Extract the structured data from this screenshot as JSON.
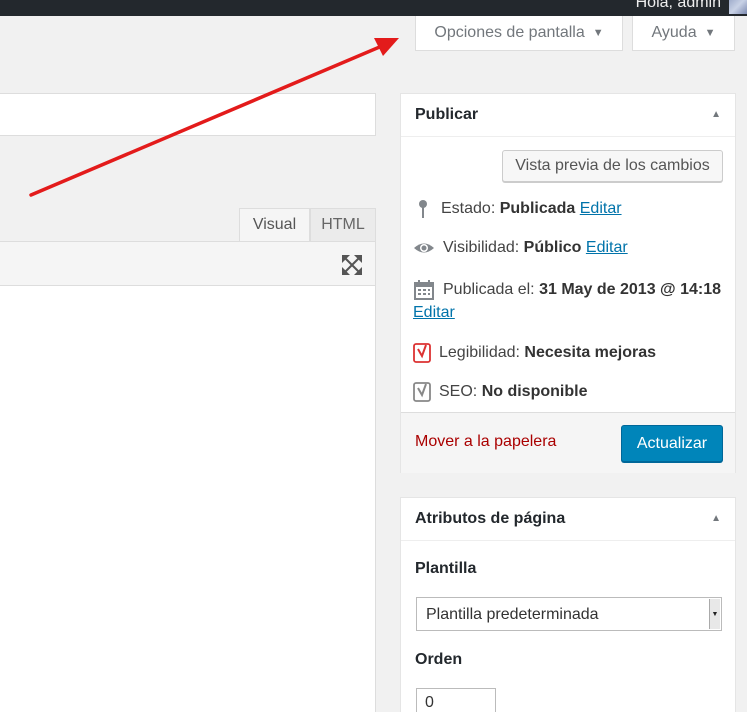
{
  "admin_bar": {
    "greeting": "Hola, admin"
  },
  "screen_meta": {
    "screen_options_label": "Opciones de pantalla",
    "help_label": "Ayuda",
    "dropdown_glyph": "▼"
  },
  "editor": {
    "tabs": [
      {
        "label": "Visual",
        "active": true
      },
      {
        "label": "HTML",
        "active": false
      }
    ],
    "fullscreen_icon": "expand-icon"
  },
  "publish_box": {
    "title": "Publicar",
    "toggle_glyph": "▲",
    "preview_button": "Vista previa de los cambios",
    "status": {
      "label": "Estado:",
      "value": "Publicada",
      "edit": "Editar",
      "icon": "pin-icon"
    },
    "visibility": {
      "label": "Visibilidad:",
      "value": "Público",
      "edit": "Editar",
      "icon": "eye-icon"
    },
    "published": {
      "label": "Publicada el:",
      "value": "31 May de 2013 @ 14:18",
      "edit": "Editar",
      "icon": "calendar-icon"
    },
    "readability": {
      "label": "Legibilidad:",
      "value": "Necesita mejoras",
      "icon": "yoast-readability-icon",
      "color": "#dc3232"
    },
    "seo": {
      "label": "SEO:",
      "value": "No disponible",
      "icon": "yoast-seo-icon",
      "color": "#888888"
    },
    "trash_link": "Mover a la papelera",
    "update_button": "Actualizar"
  },
  "attributes_box": {
    "title": "Atributos de página",
    "toggle_glyph": "▲",
    "template_label": "Plantilla",
    "template_value": "Plantilla predeterminada",
    "order_label": "Orden",
    "order_value": "0"
  },
  "colors": {
    "accent": "#0085ba",
    "link": "#0073aa",
    "trash": "#aa0000",
    "annotation_arrow": "#e31b1b"
  }
}
